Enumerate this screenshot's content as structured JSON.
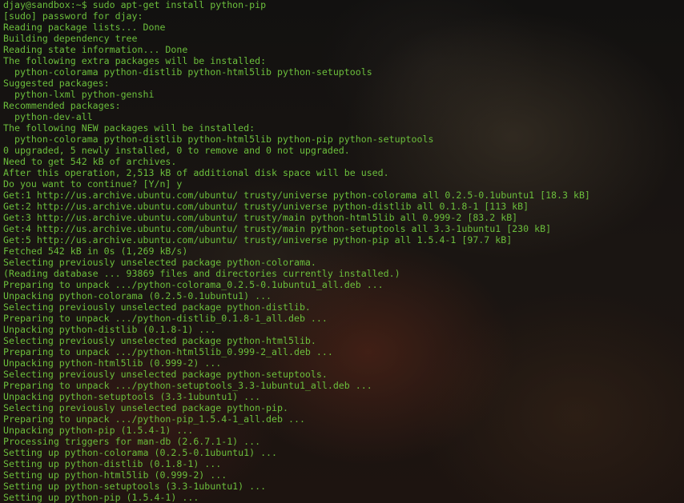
{
  "terminal": {
    "colors": {
      "text": "#6cbf3c",
      "background": "#0e0d0c"
    },
    "lines": [
      "djay@sandbox:~$ sudo apt-get install python-pip",
      "[sudo] password for djay:",
      "Reading package lists... Done",
      "Building dependency tree",
      "Reading state information... Done",
      "The following extra packages will be installed:",
      "  python-colorama python-distlib python-html5lib python-setuptools",
      "Suggested packages:",
      "  python-lxml python-genshi",
      "Recommended packages:",
      "  python-dev-all",
      "The following NEW packages will be installed:",
      "  python-colorama python-distlib python-html5lib python-pip python-setuptools",
      "0 upgraded, 5 newly installed, 0 to remove and 0 not upgraded.",
      "Need to get 542 kB of archives.",
      "After this operation, 2,513 kB of additional disk space will be used.",
      "Do you want to continue? [Y/n] y",
      "Get:1 http://us.archive.ubuntu.com/ubuntu/ trusty/universe python-colorama all 0.2.5-0.1ubuntu1 [18.3 kB]",
      "Get:2 http://us.archive.ubuntu.com/ubuntu/ trusty/universe python-distlib all 0.1.8-1 [113 kB]",
      "Get:3 http://us.archive.ubuntu.com/ubuntu/ trusty/main python-html5lib all 0.999-2 [83.2 kB]",
      "Get:4 http://us.archive.ubuntu.com/ubuntu/ trusty/main python-setuptools all 3.3-1ubuntu1 [230 kB]",
      "Get:5 http://us.archive.ubuntu.com/ubuntu/ trusty/universe python-pip all 1.5.4-1 [97.7 kB]",
      "Fetched 542 kB in 0s (1,269 kB/s)",
      "Selecting previously unselected package python-colorama.",
      "(Reading database ... 93869 files and directories currently installed.)",
      "Preparing to unpack .../python-colorama_0.2.5-0.1ubuntu1_all.deb ...",
      "Unpacking python-colorama (0.2.5-0.1ubuntu1) ...",
      "Selecting previously unselected package python-distlib.",
      "Preparing to unpack .../python-distlib_0.1.8-1_all.deb ...",
      "Unpacking python-distlib (0.1.8-1) ...",
      "Selecting previously unselected package python-html5lib.",
      "Preparing to unpack .../python-html5lib_0.999-2_all.deb ...",
      "Unpacking python-html5lib (0.999-2) ...",
      "Selecting previously unselected package python-setuptools.",
      "Preparing to unpack .../python-setuptools_3.3-1ubuntu1_all.deb ...",
      "Unpacking python-setuptools (3.3-1ubuntu1) ...",
      "Selecting previously unselected package python-pip.",
      "Preparing to unpack .../python-pip_1.5.4-1_all.deb ...",
      "Unpacking python-pip (1.5.4-1) ...",
      "Processing triggers for man-db (2.6.7.1-1) ...",
      "Setting up python-colorama (0.2.5-0.1ubuntu1) ...",
      "Setting up python-distlib (0.1.8-1) ...",
      "Setting up python-html5lib (0.999-2) ...",
      "Setting up python-setuptools (3.3-1ubuntu1) ...",
      "Setting up python-pip (1.5.4-1) ..."
    ]
  }
}
